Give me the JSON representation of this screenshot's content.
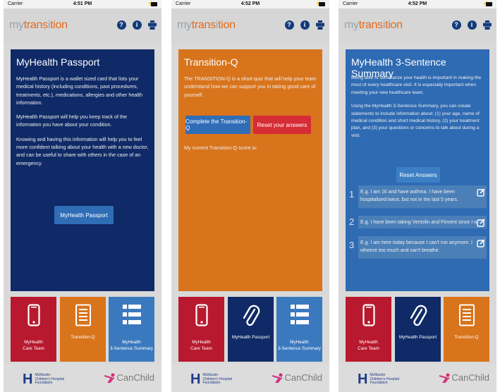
{
  "screens": [
    {
      "status": {
        "carrier": "Carrier",
        "time": "4:51 PM"
      },
      "logo": {
        "part1": "mytrans",
        "part2": "i",
        "part3": "tion"
      },
      "card": {
        "title": "MyHealth Passport",
        "paragraphs": [
          "MyHealth Passport is a wallet sized card that lists your medical history (including conditions, past procedures, treatments, etc.), medications, allergies and other health information.",
          "MyHealth Passport will help you keep track of the information you have about your condition.",
          "Knowing and having this information will help you to feel more confident talking about your health with a new doctor, and can be useful to share with others in the case of an emergency."
        ],
        "button": "MyHealth Passport"
      },
      "tiles": [
        {
          "label1": "MyHealth",
          "label2": "Care Team"
        },
        {
          "label1": "Transition-Q",
          "label2": ""
        },
        {
          "label1": "MyHealth",
          "label2": "3-Sentence Summary"
        }
      ]
    },
    {
      "status": {
        "carrier": "Carrier",
        "time": "4:52 PM"
      },
      "card": {
        "title": "Transition-Q",
        "paragraphs": [
          "The TRANSITION-Q is a short quiz that will help your team understand how we can support you in taking good care of yourself."
        ],
        "button_complete": "Complete the Transition-Q",
        "button_reset": "Reset your answers",
        "score_label": "My current Transition-Q score is:"
      },
      "tiles": [
        {
          "label1": "MyHealth",
          "label2": "Care Team"
        },
        {
          "label1": "MyHealth Passport",
          "label2": ""
        },
        {
          "label1": "MyHealth",
          "label2": "3-Sentence Summary"
        }
      ]
    },
    {
      "status": {
        "carrier": "Carrier",
        "time": "4:52 PM"
      },
      "card": {
        "title": "MyHealth 3-Sentence Summary",
        "paragraphs": [
          "Being able to summarize your health is important in making the most of every healthcare visit. It is especially important when meeting your new healthcare team.",
          "Using the MyHealth 3-Sentence Summary, you can create statements to include information about: (1) your age, name of medical condition and short medical history, (2) your treatment plan, and (3) your questions or concerns to talk about during a visit."
        ],
        "button_reset": "Reset Answers",
        "summary": [
          {
            "num": "1",
            "text": "E.g. I am 16 and have asthma. I have been hospitalized twice, but not in the last 5 years."
          },
          {
            "num": "2",
            "text": "E.g. I have been taking Ventolin and Flovent since I was"
          },
          {
            "num": "3",
            "text": "E.g. I am here today because I can't run anymore. I wheeze too much and can't breathe."
          }
        ]
      },
      "tiles": [
        {
          "label1": "MyHealth",
          "label2": "Care Team"
        },
        {
          "label1": "MyHealth Passport",
          "label2": ""
        },
        {
          "label1": "Transition-Q",
          "label2": ""
        }
      ]
    }
  ],
  "footer": {
    "mcmaster_line1": "McMaster",
    "mcmaster_line2": "Children's Hospital",
    "mcmaster_line3": "Foundation",
    "canchild": "CanChild"
  },
  "colors": {
    "navy": "#0f2a66",
    "orange": "#d8741c",
    "blue": "#2f6bb3",
    "red": "#b8192e",
    "tile_blue": "#3b79bf",
    "button_blue": "#2f6db7",
    "button_red": "#d62c35"
  },
  "icons": [
    "help-icon",
    "info-icon",
    "print-icon",
    "phone-icon",
    "checklist-icon",
    "list-icon",
    "paperclip-icon",
    "edit-icon"
  ]
}
